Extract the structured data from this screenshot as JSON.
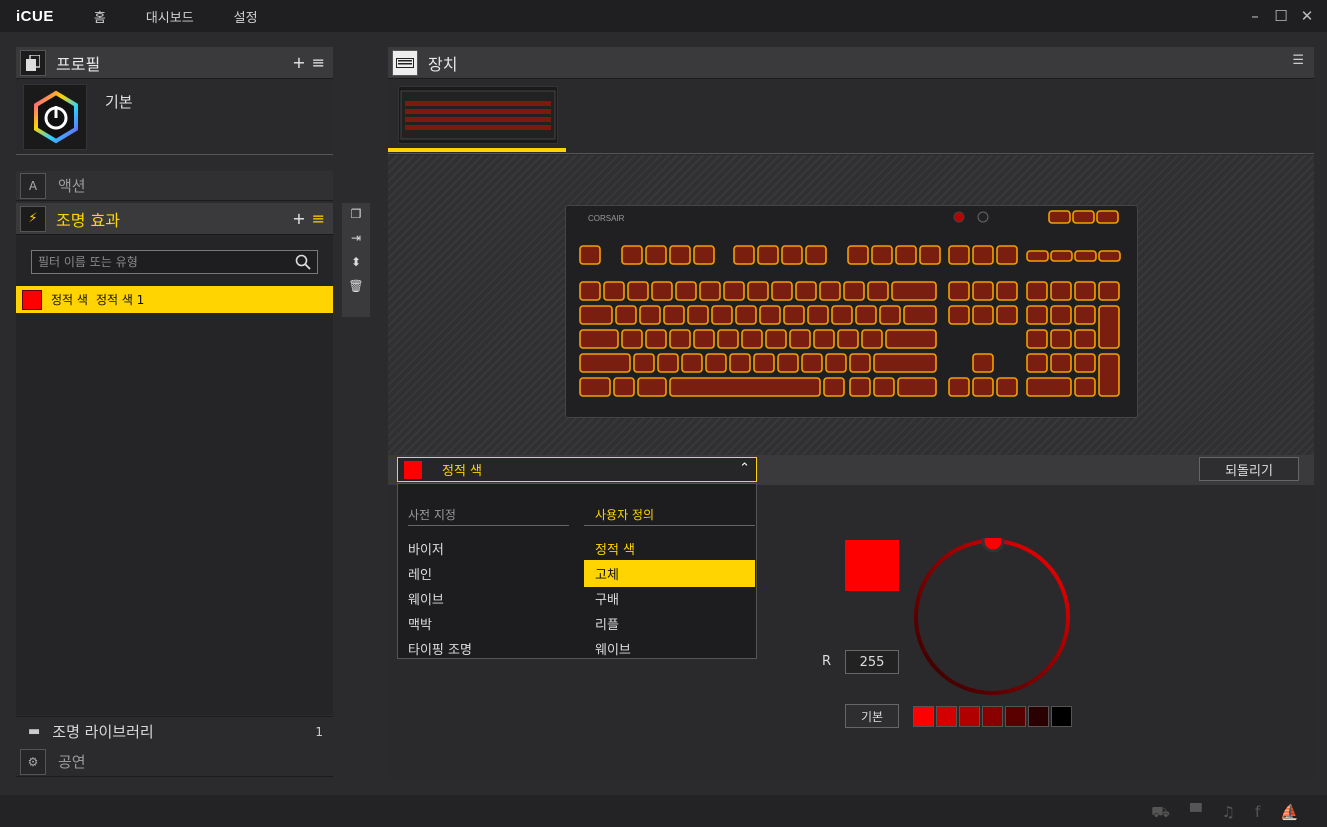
{
  "app": {
    "name": "iCUE"
  },
  "nav": [
    "홈",
    "대시보드",
    "설정"
  ],
  "window_controls": {
    "minimize": "–",
    "maximize": "☐",
    "close": "✕"
  },
  "profiles": {
    "title": "프로필",
    "add": "+",
    "menu": "≡",
    "current": "기본"
  },
  "actions": {
    "label": "액션"
  },
  "lighting": {
    "title": "조명 효과",
    "add": "+",
    "menu": "≡",
    "filter_placeholder": "필터 이름 또는 유형",
    "items": [
      {
        "type": "정적 색",
        "name": "정적 색 1"
      }
    ]
  },
  "library": {
    "label": "조명 라이브러리",
    "count": "1"
  },
  "performance": {
    "label": "공연"
  },
  "devices": {
    "title": "장치"
  },
  "keyboard": {
    "brand": "CORSAIR"
  },
  "effect_editor": {
    "selected_effect": "정적 색",
    "revert_label": "되돌리기",
    "menu": {
      "preset_header": "사전 지정",
      "custom_header": "사용자 정의",
      "presets": [
        "바이저",
        "레인",
        "웨이브",
        "맥박",
        "타이핑 조명"
      ],
      "custom": [
        "정적 색",
        "고체",
        "구배",
        "리플",
        "웨이브"
      ],
      "highlighted": "고체"
    },
    "color": {
      "r_label": "R",
      "r_value": "255",
      "default_label": "기본"
    },
    "preset_colors": [
      "#ff0000",
      "#d40000",
      "#b00000",
      "#8a0000",
      "#5a0000",
      "#2a0000",
      "#000000"
    ]
  },
  "colors": {
    "accent": "#ffd400",
    "selected": "#ff0000"
  },
  "footer_icons": [
    "drive-icon",
    "chat-icon",
    "twitter-icon",
    "facebook-icon",
    "corsair-icon"
  ]
}
